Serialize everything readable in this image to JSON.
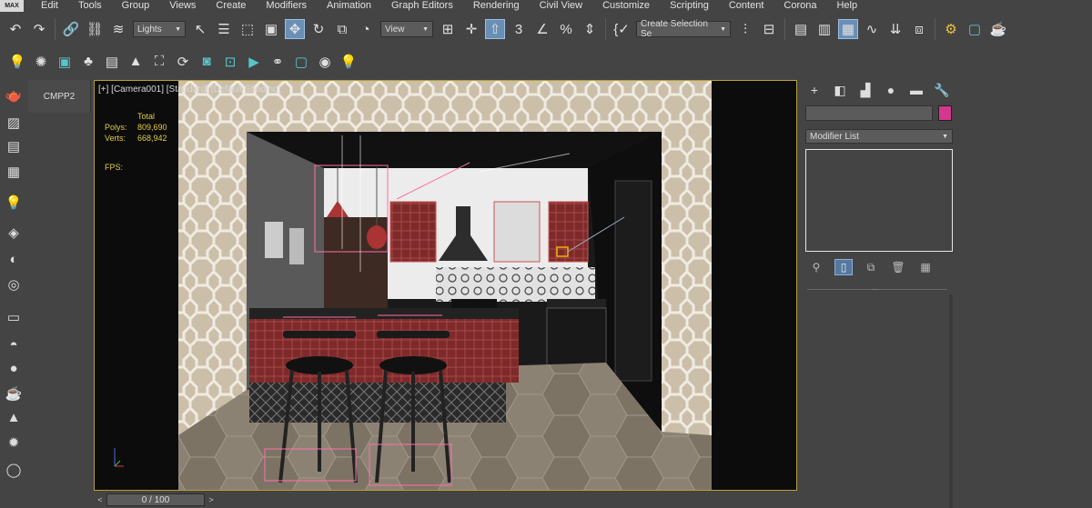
{
  "app_logo": "MAX",
  "menu": [
    "Edit",
    "Tools",
    "Group",
    "Views",
    "Create",
    "Modifiers",
    "Animation",
    "Graph Editors",
    "Rendering",
    "Civil View",
    "Customize",
    "Scripting",
    "Content",
    "Corona",
    "Help"
  ],
  "toolbar": {
    "filter_select": "Lights",
    "refcoord_select": "View",
    "selection_set": "Create Selection Se"
  },
  "scene_explorer_tab": "CMPP2",
  "viewport": {
    "label": "[+] [Camera001] [Standard] [Default Shading]",
    "stats_header": "Total",
    "polys_label": "Polys:",
    "polys_value": "809,690",
    "verts_label": "Verts:",
    "verts_value": "668,942",
    "fps_label": "FPS:"
  },
  "timeline": {
    "frame": "0 / 100"
  },
  "command_panel": {
    "modifier_list": "Modifier List",
    "object_color": "#d4378e"
  },
  "colors": {
    "accent_active": "#6a8fb5",
    "viewport_border": "#b8a034",
    "stats_text": "#e0cc46"
  }
}
